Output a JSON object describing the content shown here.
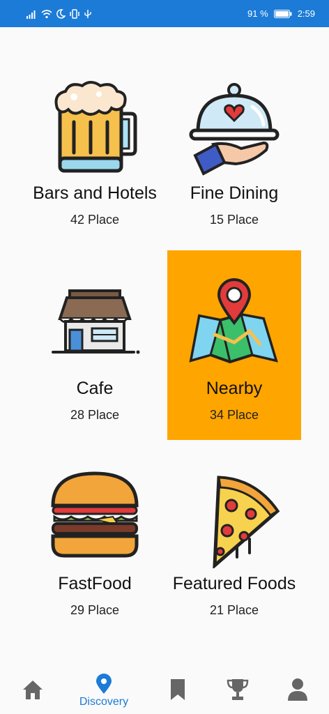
{
  "status_bar": {
    "battery": "91 %",
    "time": "2:59"
  },
  "categories": [
    {
      "title": "Bars and Hotels",
      "count": "42 Place"
    },
    {
      "title": "Fine Dining",
      "count": "15 Place"
    },
    {
      "title": "Cafe",
      "count": "28 Place"
    },
    {
      "title": "Nearby",
      "count": "34 Place"
    },
    {
      "title": "FastFood",
      "count": "29 Place"
    },
    {
      "title": "Featured Foods",
      "count": "21 Place"
    }
  ],
  "bottom_nav": {
    "active_label": "Discovery"
  },
  "colors": {
    "status_bar": "#1c7bd6",
    "highlight": "#ffa500",
    "nav_inactive": "#666666"
  }
}
